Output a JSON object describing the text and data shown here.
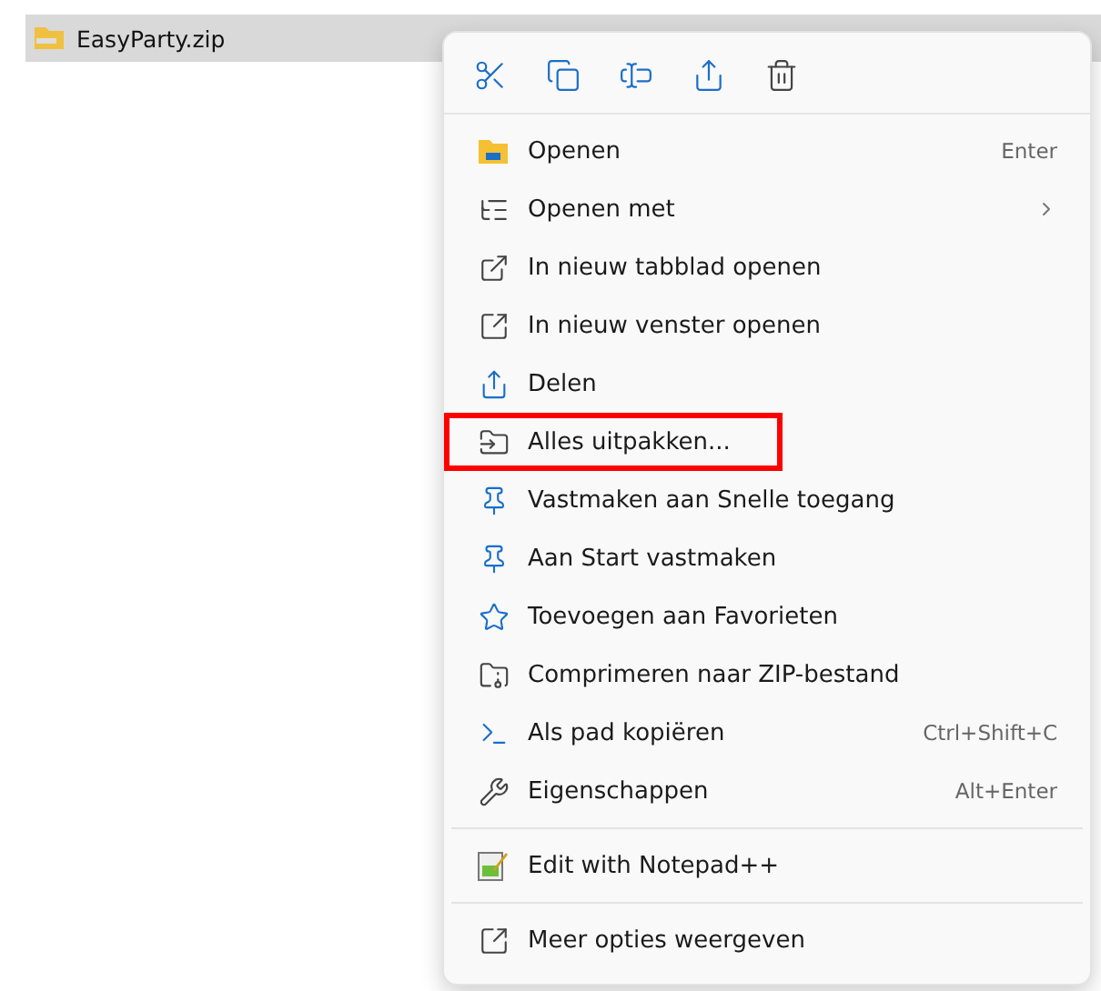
{
  "file_row": {
    "name": "EasyParty.zip",
    "selected": true
  },
  "context_menu": {
    "sections": [
      [
        {
          "label": "Openen",
          "shortcut": "Enter",
          "has_submenu": false,
          "annotated": false
        },
        {
          "label": "Openen met",
          "has_submenu": true,
          "annotated": false
        },
        {
          "label": "In nieuw tabblad openen",
          "has_submenu": false,
          "annotated": false
        },
        {
          "label": "In nieuw venster openen",
          "has_submenu": false,
          "annotated": false
        },
        {
          "label": "Delen",
          "has_submenu": false,
          "annotated": false
        },
        {
          "label": "Alles uitpakken...",
          "has_submenu": false,
          "annotated": true
        },
        {
          "label": "Vastmaken aan Snelle toegang",
          "has_submenu": false,
          "annotated": false
        },
        {
          "label": "Aan Start vastmaken",
          "has_submenu": false,
          "annotated": false
        },
        {
          "label": "Toevoegen aan Favorieten",
          "has_submenu": false,
          "annotated": false
        },
        {
          "label": "Comprimeren naar ZIP-bestand",
          "has_submenu": false,
          "annotated": false
        },
        {
          "label": "Als pad kopiëren",
          "shortcut": "Ctrl+Shift+C",
          "has_submenu": false,
          "annotated": false
        },
        {
          "label": "Eigenschappen",
          "shortcut": "Alt+Enter",
          "has_submenu": false,
          "annotated": false
        }
      ],
      [
        {
          "label": "Edit with Notepad++",
          "has_submenu": false,
          "annotated": false
        }
      ],
      [
        {
          "label": "Meer opties weergeven",
          "has_submenu": false,
          "annotated": false
        }
      ]
    ]
  }
}
